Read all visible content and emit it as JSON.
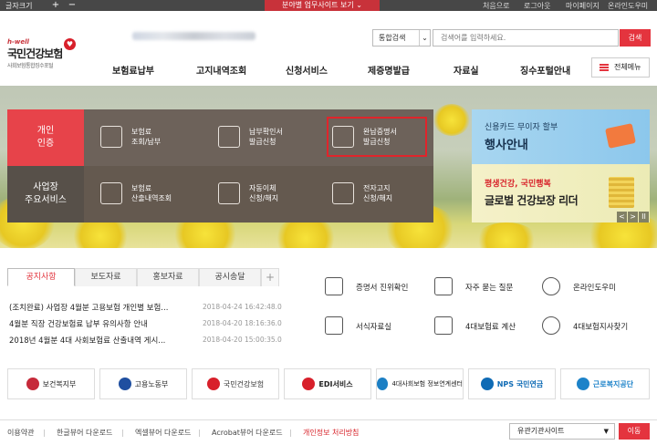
{
  "topbar": {
    "font_size_label": "글자크기",
    "plus": "+",
    "minus": "−",
    "banner": "분야별 업무사이트 보기 ⌄",
    "util_links": [
      "처음으로",
      "로그아웃",
      "마이페이지",
      "온라인도우미"
    ]
  },
  "header": {
    "logo_hwell": "h-well",
    "logo_name": "국민건강보험",
    "logo_sub": "사회보험통합징수포털",
    "search_select": "통합검색",
    "search_placeholder": "검색어를 입력하세요.",
    "search_button": "검색",
    "all_menu": "전체메뉴"
  },
  "gnb": [
    "보험료납부",
    "고지내역조회",
    "신청서비스",
    "제증명발급",
    "자료실",
    "징수포털안내"
  ],
  "hero": {
    "tab_individual": "개인\n인증",
    "tab_business": "사업장\n주요서비스",
    "row1": [
      {
        "label": "보험료\n조회/납부",
        "icon": "cursor-click-icon"
      },
      {
        "label": "납부확인서\n발급신청",
        "icon": "document-icon"
      },
      {
        "label": "완납증명서\n발급신청",
        "icon": "certificate-icon"
      }
    ],
    "row2": [
      {
        "label": "보험료\n산출내역조회",
        "icon": "calculator-icon"
      },
      {
        "label": "자동이체\n신청/해지",
        "icon": "money-bag-icon"
      },
      {
        "label": "전자고지\n신청/해지",
        "icon": "email-notice-icon"
      }
    ],
    "ad1_line1": "신용카드 무이자 할부",
    "ad1_line2": "행사안내",
    "ad2_line1": "평생건강, 국민행복",
    "ad2_line2": "글로벌 건강보장 리더",
    "ad_controls": [
      "<",
      ">",
      "II"
    ]
  },
  "notice": {
    "tabs": [
      "공지사항",
      "보도자료",
      "홍보자료",
      "공시송달"
    ],
    "plus": "+",
    "items": [
      {
        "title": "(조치완료) 사업장 4월분 고용보험 개인별 보험...",
        "date": "2018-04-24 16:42:48.0"
      },
      {
        "title": "4월분 직장 건강보험료 납부 유의사항 안내",
        "date": "2018-04-20 18:16:36.0"
      },
      {
        "title": "2018년 4월분 4대 사회보험료 산출내역 게시...",
        "date": "2018-04-20 15:00:35.0"
      }
    ]
  },
  "quicklinks": [
    {
      "label": "증명서 진위확인",
      "icon": "verify-document-icon"
    },
    {
      "label": "자주 묻는 질문",
      "icon": "faq-icon"
    },
    {
      "label": "온라인도우미",
      "icon": "headset-icon"
    },
    {
      "label": "서식자료실",
      "icon": "form-library-icon"
    },
    {
      "label": "4대보험료 계산",
      "icon": "calculator-icon"
    },
    {
      "label": "4대보험지사찾기",
      "icon": "location-pin-icon"
    }
  ],
  "partners": [
    {
      "label": "보건복지부",
      "color": "#c62a3a"
    },
    {
      "label": "고용노동부",
      "color": "#1f4fa0"
    },
    {
      "label": "국민건강보험",
      "color": "#d8202b"
    },
    {
      "label": "EDI서비스",
      "color": "#d8202b"
    },
    {
      "label": "4대사회보험 정보연계센터",
      "color": "#1c7fc4"
    },
    {
      "label": "NPS 국민연금",
      "color": "#0f6bb5"
    },
    {
      "label": "근로복지공단",
      "color": "#1d83c9"
    }
  ],
  "footer": {
    "links": [
      "이용약관",
      "한글뷰어 다운로드",
      "엑셀뷰어 다운로드",
      "Acrobat뷰어 다운로드",
      "개인정보 처리방침"
    ],
    "select": "유관기관사이트",
    "go": "이동"
  },
  "colors": {
    "accent": "#e4343e",
    "panel": "#6d625a",
    "topbar": "#474747"
  }
}
